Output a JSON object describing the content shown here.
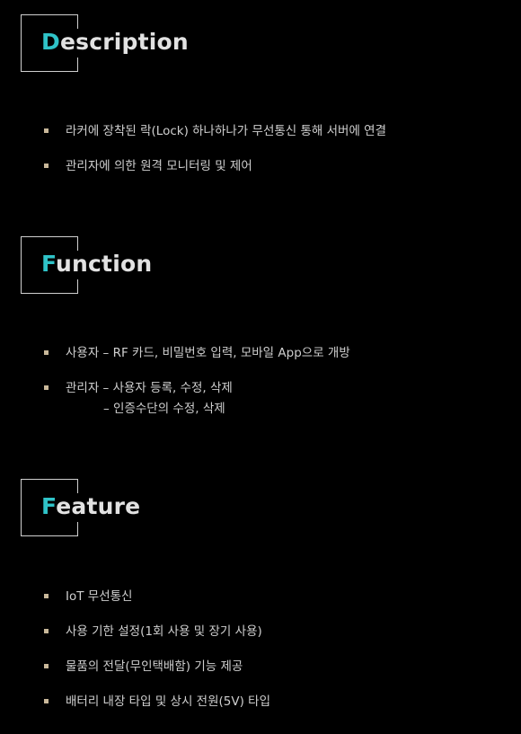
{
  "sections": [
    {
      "title_first": "D",
      "title_rest": "escription",
      "items": [
        "라커에 장착된 락(Lock) 하나하나가 무선통신 통해 서버에 연결",
        "관리자에 의한 원격 모니터링 및 제어"
      ]
    },
    {
      "title_first": "F",
      "title_rest": "unction",
      "items": [
        "사용자 – RF 카드, 비밀번호 입력, 모바일 App으로 개방",
        "관리자 – 사용자 등록, 수정, 삭제"
      ],
      "continuation": "– 인증수단의 수정, 삭제"
    },
    {
      "title_first": "F",
      "title_rest": "eature",
      "items": [
        "IoT 무선통신",
        "사용 기한 설정(1회 사용 및 장기 사용)",
        "물품의 전달(무인택배함) 기능 제공",
        "배터리 내장 타입 및 상시 전원(5V) 타입"
      ]
    }
  ],
  "colors": {
    "background": "#000000",
    "accent": "#2fc3c8",
    "bullet": "#c9b89a",
    "text": "#cfcfcf"
  }
}
